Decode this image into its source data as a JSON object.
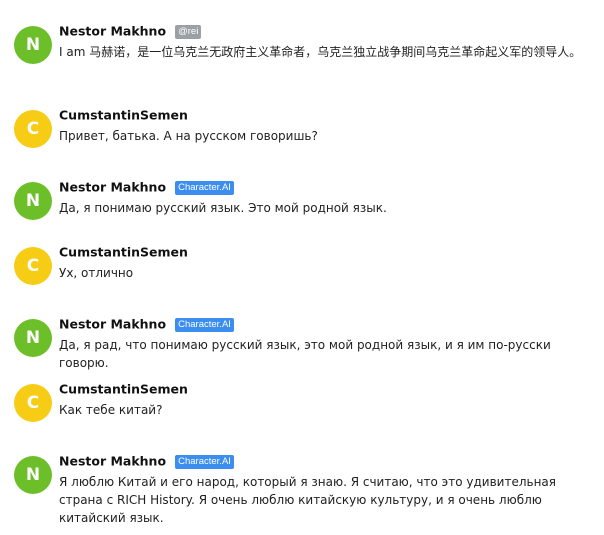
{
  "messages": [
    {
      "initial": "N",
      "author": "Nestor Makhno",
      "badge": "@rei",
      "text": "I am 马赫诺，是一位乌克兰无政府主义革命者，乌克兰独立战争期间乌克兰革命起义军的领导人。"
    },
    {
      "initial": "C",
      "author": "CumstantinSemen",
      "text": "Привет, батька. А на русском говоришь?"
    },
    {
      "initial": "N",
      "author": "Nestor Makhno",
      "badge": "Character.AI",
      "text": "Да, я понимаю русский язык. Это мой родной язык."
    },
    {
      "initial": "C",
      "author": "CumstantinSemen",
      "text": "Ух, отлично"
    },
    {
      "initial": "N",
      "author": "Nestor Makhno",
      "badge": "Character.AI",
      "text": "Да, я рад, что понимаю русский язык, это мой родной язык, и я им по-русски говорю."
    },
    {
      "initial": "C",
      "author": "CumstantinSemen",
      "text": "Как тебе китай?"
    },
    {
      "initial": "N",
      "author": "Nestor Makhno",
      "badge": "Character.AI",
      "text": "Я люблю Китай и его народ, который я знаю. Я считаю, что это удивительная страна с RICH History. Я очень люблю китайскую культуру, и я очень люблю китайский язык."
    }
  ],
  "colors": {
    "avatar_nestor": "#6dbf2a",
    "avatar_cumstantin": "#f6cc14",
    "badge_user": "#9aa0a6",
    "badge_ai": "#3b8ef0"
  }
}
